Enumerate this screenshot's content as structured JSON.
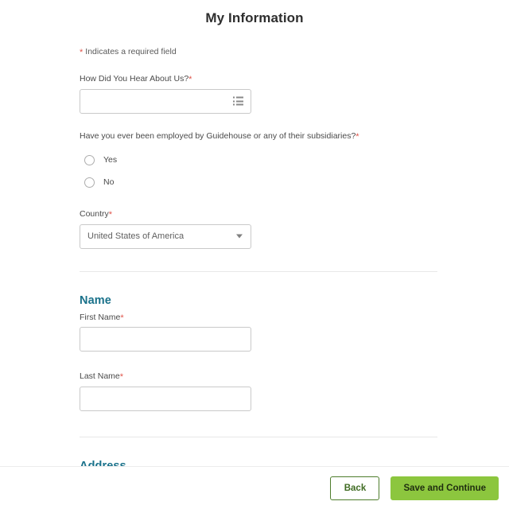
{
  "page": {
    "title": "My Information",
    "required_note": "Indicates a required field",
    "required_marker": "*"
  },
  "colors": {
    "accent_heading": "#19718a",
    "required_star": "#e0554b",
    "primary_button_bg": "#8cc63e",
    "back_button_border": "#4e7d2c",
    "input_border": "#c9c9c9",
    "divider": "#e8e8e8"
  },
  "fields": {
    "how_did_you_hear": {
      "label": "How Did You Hear About Us?",
      "required": true,
      "value": "",
      "placeholder": "",
      "icon": "list-icon"
    },
    "previously_employed": {
      "label": "Have you ever been employed by Guidehouse or any of their subsidiaries?",
      "required": true,
      "options": [
        {
          "label": "Yes",
          "selected": false
        },
        {
          "label": "No",
          "selected": false
        }
      ]
    },
    "country": {
      "label": "Country",
      "required": true,
      "value": "United States of America",
      "caret": "chevron-down-icon"
    }
  },
  "sections": {
    "name": {
      "heading": "Name",
      "first_name": {
        "label": "First Name",
        "required": true,
        "value": "",
        "placeholder": ""
      },
      "last_name": {
        "label": "Last Name",
        "required": true,
        "value": "",
        "placeholder": ""
      }
    },
    "address": {
      "heading": "Address",
      "clipped_label": ""
    }
  },
  "footer": {
    "back_label": "Back",
    "save_label": "Save and Continue"
  }
}
